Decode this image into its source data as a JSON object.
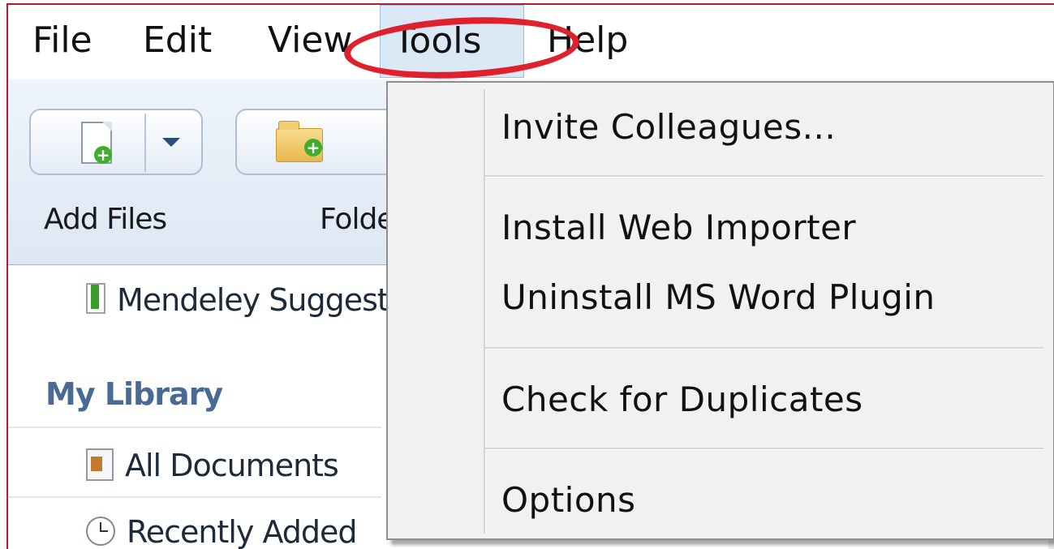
{
  "menubar": {
    "items": [
      {
        "label": "File"
      },
      {
        "label": "Edit"
      },
      {
        "label": "View"
      },
      {
        "label": "Tools"
      },
      {
        "label": "Help"
      }
    ],
    "active": "Tools"
  },
  "toolbar": {
    "add_files_label": "Add Files",
    "folder_label": "Folder"
  },
  "sidebar": {
    "suggest_item": "Mendeley Suggest",
    "section_title": "My Library",
    "items": [
      {
        "label": "All Documents",
        "icon": "documents-icon"
      },
      {
        "label": "Recently Added",
        "icon": "clock-icon"
      }
    ]
  },
  "tools_menu": {
    "items": [
      {
        "label": "Invite Colleagues..."
      },
      {
        "label": "Install Web Importer"
      },
      {
        "label": "Uninstall MS Word Plugin"
      },
      {
        "label": "Check for Duplicates"
      },
      {
        "label": "Options"
      }
    ]
  },
  "colors": {
    "highlight_ellipse": "#e0202c",
    "frame": "#b01c2e",
    "section_title": "#4a6a96",
    "active_menu_bg": "#dbe8f6"
  }
}
